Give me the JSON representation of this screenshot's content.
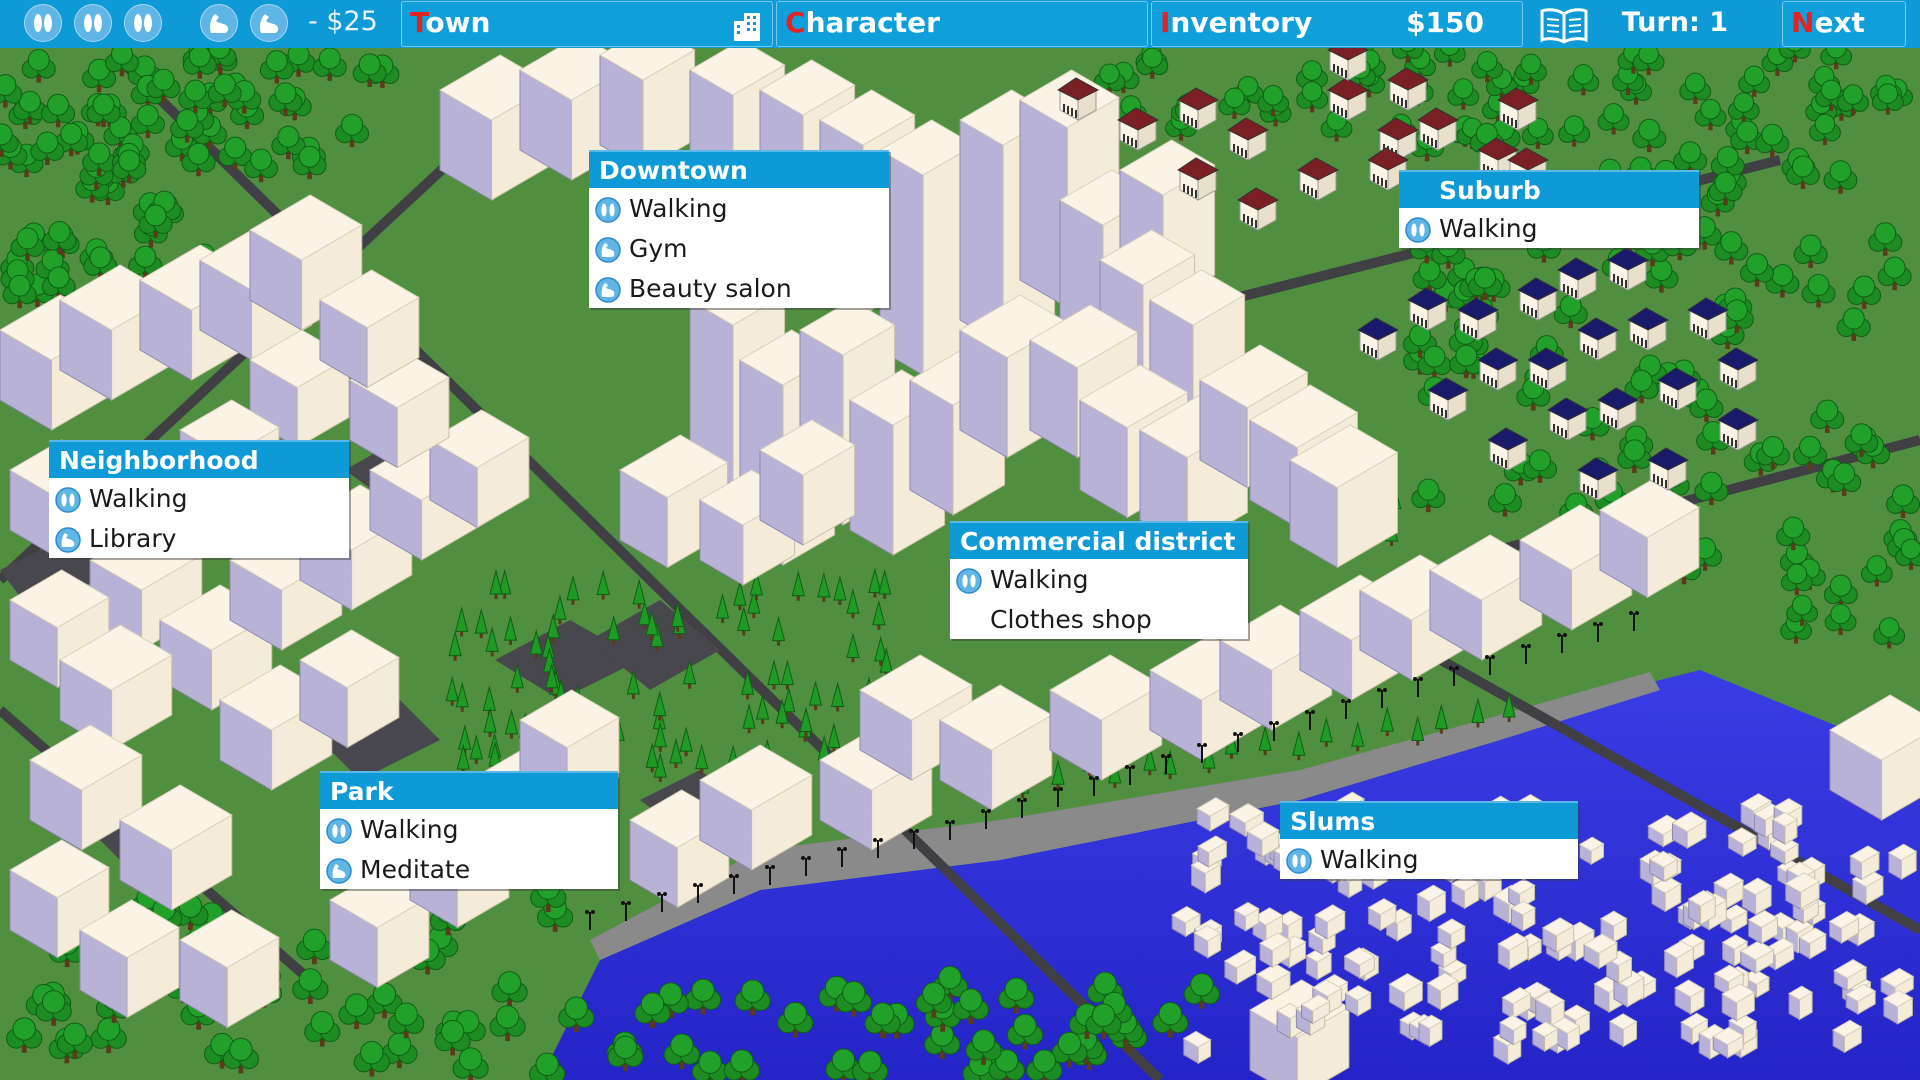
{
  "topbar": {
    "walk_icons": [
      "foot-icon",
      "foot-icon",
      "foot-icon"
    ],
    "muscle_icons": [
      "muscle-icon",
      "muscle-icon"
    ],
    "cost": "- $25",
    "town_label": "own",
    "town_first": "T",
    "character_label": "haracter",
    "character_first": "C",
    "inventory_label": "nventory",
    "inventory_first": "I",
    "money": "$150",
    "turn": "Turn: 1",
    "next_label": "ext",
    "next_first": "N"
  },
  "locations": [
    {
      "title": "Downtown",
      "actions": [
        {
          "icon": "foot-icon",
          "label": "Walking"
        },
        {
          "icon": "muscle-icon",
          "label": "Gym"
        },
        {
          "icon": "muscle-icon",
          "label": "Beauty salon"
        }
      ]
    },
    {
      "title": "Suburb",
      "actions": [
        {
          "icon": "foot-icon",
          "label": "Walking"
        }
      ]
    },
    {
      "title": "Neighborhood",
      "actions": [
        {
          "icon": "foot-icon",
          "label": "Walking"
        },
        {
          "icon": "muscle-icon",
          "label": "Library"
        }
      ]
    },
    {
      "title": "Commercial district",
      "actions": [
        {
          "icon": "foot-icon",
          "label": "Walking"
        },
        {
          "icon": "",
          "label": "Clothes shop"
        }
      ]
    },
    {
      "title": "Park",
      "actions": [
        {
          "icon": "foot-icon",
          "label": "Walking"
        },
        {
          "icon": "muscle-icon",
          "label": "Meditate"
        }
      ]
    },
    {
      "title": "Slums",
      "actions": [
        {
          "icon": "foot-icon",
          "label": "Walking"
        }
      ]
    }
  ],
  "colors": {
    "bar": "#0d9ad6",
    "accent_letter": "#e32222",
    "grass": "#4f8f3f",
    "river": "#2d2fd6",
    "tree": "#1c8c23",
    "building_top": "#fbf4e6",
    "building_side": "#b8b2d6"
  }
}
